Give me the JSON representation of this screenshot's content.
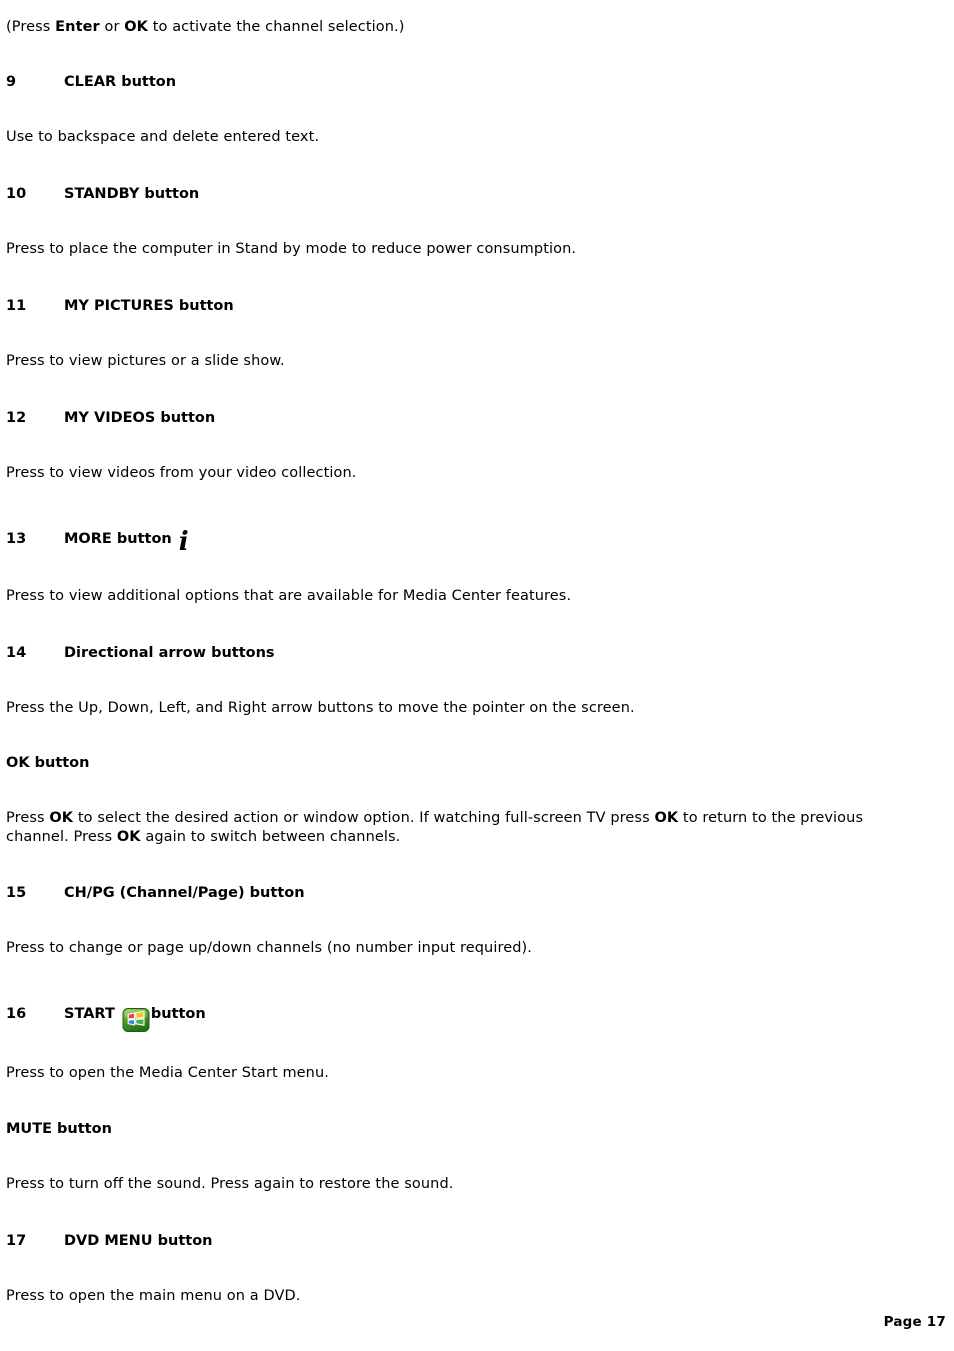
{
  "document": {
    "intro_line": {
      "prefix": "(Press ",
      "bold1": "Enter",
      "middle": " or ",
      "bold2": "OK",
      "suffix": " to activate the channel selection.)"
    },
    "sections": [
      {
        "number": "9",
        "label": "CLEAR button",
        "body": "Use to backspace and delete entered text."
      },
      {
        "number": "10",
        "label": "STANDBY button",
        "body": "Press to place the computer in Stand by mode to reduce power consumption."
      },
      {
        "number": "11",
        "label": "MY PICTURES button",
        "body": "Press to view pictures or a slide show."
      },
      {
        "number": "12",
        "label": "MY VIDEOS button",
        "body": "Press to view videos from your video collection."
      },
      {
        "number": "13",
        "label": "MORE button",
        "icon": "info-italic-i-icon",
        "body": "Press to view additional options that are available for Media Center features."
      },
      {
        "number": "14",
        "label": "Directional arrow buttons",
        "body": "Press the Up, Down, Left, and Right arrow buttons to move the pointer on the screen."
      },
      {
        "number": "15",
        "label": "CH/PG (Channel/Page) button",
        "body": "Press to change or page up/down channels (no number input required)."
      },
      {
        "number": "16",
        "label_before": "START",
        "label_after": "button",
        "icon": "windows-start-icon",
        "body": "Press to open the Media Center Start menu."
      },
      {
        "number": "17",
        "label": "DVD MENU button",
        "body": "Press to open the main menu on a DVD."
      }
    ],
    "ok_button": {
      "heading": "OK button",
      "line1_a": "Press ",
      "line1_b1": "OK",
      "line1_c": " to select the desired action or window option. If watching full-screen TV press ",
      "line1_b2": "OK",
      "line1_d": " to return to the previous channel. Press ",
      "line1_b3": "OK",
      "line1_e": " again to switch between channels."
    },
    "mute_button": {
      "heading": "MUTE button",
      "body": "Press to turn off the sound. Press again to restore the sound."
    },
    "footer": {
      "page_label": "Page 17"
    },
    "colors": {
      "text": "#000000",
      "background": "#ffffff",
      "start_icon_green_light": "#8cc63f",
      "start_icon_green_dark": "#2e7d1e",
      "flag_red": "#e8453c",
      "flag_green": "#4caf50",
      "flag_blue": "#3b82d6",
      "flag_yellow": "#f5c518"
    }
  }
}
